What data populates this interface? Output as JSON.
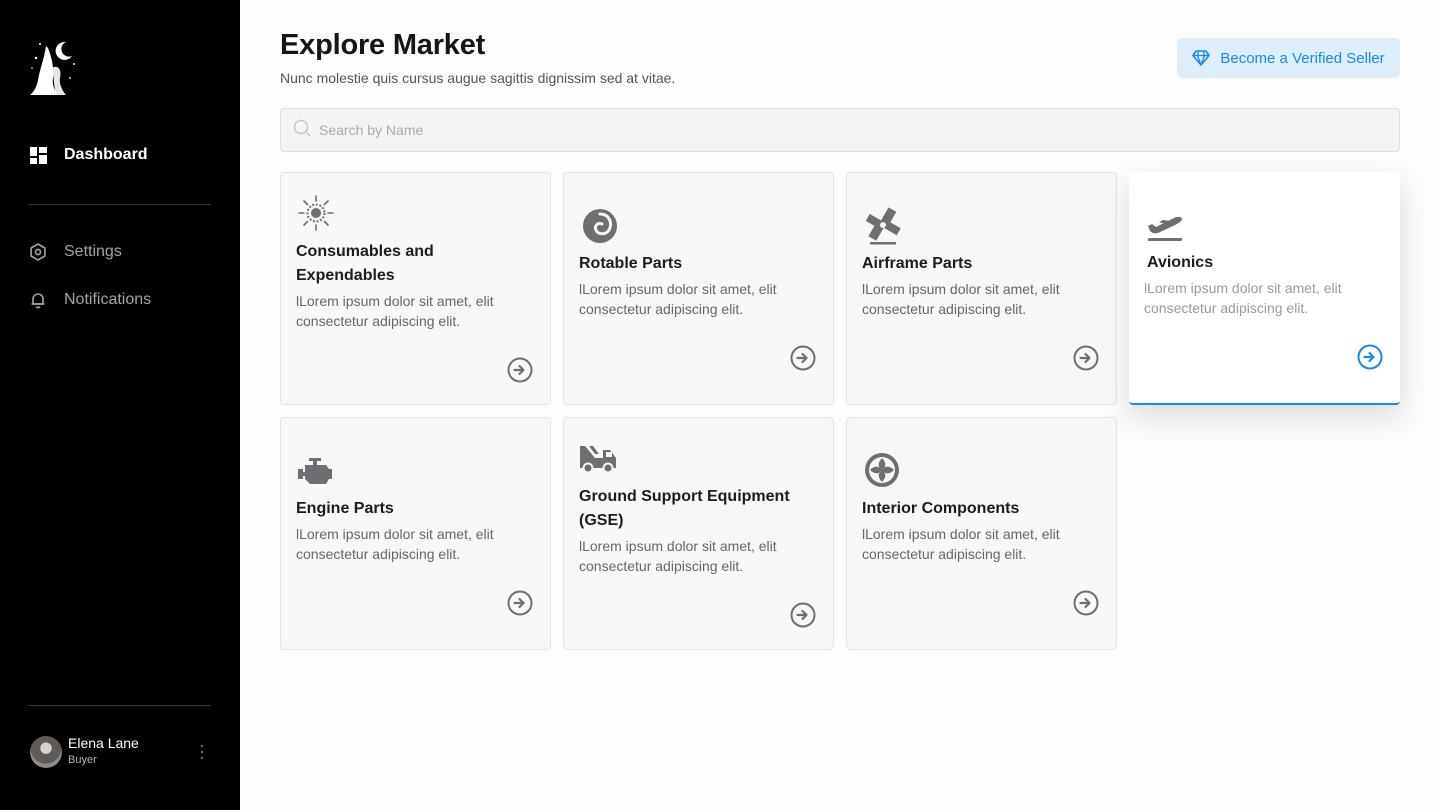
{
  "sidebar": {
    "nav": [
      {
        "label": "Dashboard",
        "icon": "dashboard-grid-icon",
        "active": true
      },
      {
        "label": "Settings",
        "icon": "gear-icon",
        "active": false
      },
      {
        "label": "Notifications",
        "icon": "bell-icon",
        "active": false
      }
    ],
    "user": {
      "name": "Elena Lane",
      "role": "Buyer"
    }
  },
  "header": {
    "title": "Explore Market",
    "subtitle": "Nunc molestie quis cursus augue sagittis dignissim sed at vitae.",
    "cta_label": "Become a Verified Seller"
  },
  "search": {
    "placeholder": "Search by Name",
    "value": ""
  },
  "cards": [
    {
      "title": "Consumables and Expendables",
      "description": "lLorem ipsum dolor sit amet, elit consectetur adipiscing elit.",
      "icon": "sun-gear-icon"
    },
    {
      "title": "Rotable Parts",
      "description": "lLorem ipsum dolor sit amet, elit consectetur adipiscing elit.",
      "icon": "spiral-icon"
    },
    {
      "title": "Airframe Parts",
      "description": "lLorem ipsum dolor sit amet, elit consectetur adipiscing elit.",
      "icon": "windmill-icon"
    },
    {
      "title": "Avionics",
      "description": "lLorem ipsum dolor sit amet, elit consectetur adipiscing elit.",
      "icon": "plane-takeoff-icon"
    },
    {
      "title": "Engine Parts",
      "description": "lLorem ipsum dolor sit amet, elit consectetur adipiscing elit.",
      "icon": "engine-icon"
    },
    {
      "title": "Ground Support Equipment (GSE)",
      "description": "lLorem ipsum dolor sit amet, elit consectetur adipiscing elit.",
      "icon": "truck-icon"
    },
    {
      "title": "Interior Components",
      "description": "lLorem ipsum dolor sit amet, elit consectetur adipiscing elit.",
      "icon": "fan-icon"
    }
  ],
  "colors": {
    "accent": "#1a8ae6",
    "accent_bg": "#dcedfb",
    "sidebar_bg": "#000000",
    "icon_gray": "#6e6e73"
  }
}
